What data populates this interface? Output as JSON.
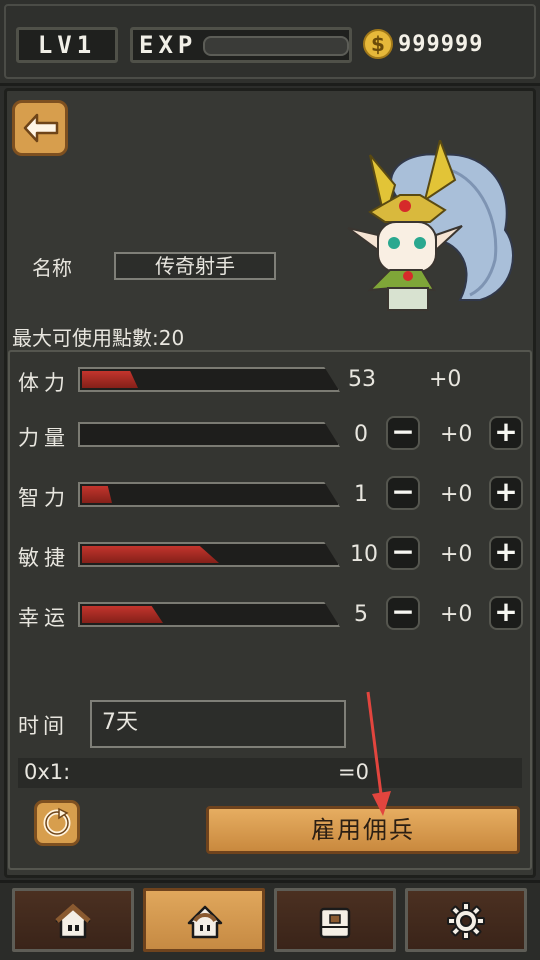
{
  "header": {
    "level": "LV1",
    "exp_label": "EXP",
    "coin_symbol": "$",
    "gold": "999999"
  },
  "panel": {
    "name_label": "名称",
    "name_value": "传奇射手",
    "max_points": "最大可使用點數:20",
    "stats": [
      {
        "label": "体力",
        "value": "53",
        "bonus": "+0",
        "fill": 0.22,
        "buttons": false
      },
      {
        "label": "力量",
        "value": "0",
        "bonus": "+0",
        "fill": 0.0,
        "buttons": true
      },
      {
        "label": "智力",
        "value": "1",
        "bonus": "+0",
        "fill": 0.12,
        "buttons": true
      },
      {
        "label": "敏捷",
        "value": "10",
        "bonus": "+0",
        "fill": 0.54,
        "buttons": true
      },
      {
        "label": "幸运",
        "value": "5",
        "bonus": "+0",
        "fill": 0.32,
        "buttons": true
      }
    ],
    "minus": "−",
    "plus": "+",
    "time_label": "时间",
    "time_value": "7天",
    "cost_left": "0x1:",
    "cost_right": "=0",
    "hire_button": "雇用佣兵"
  },
  "nav": [
    {
      "icon": "house-icon"
    },
    {
      "icon": "character-icon"
    },
    {
      "icon": "chest-icon"
    },
    {
      "icon": "gear-icon"
    }
  ],
  "colors": {
    "accent": "#d79e4d",
    "bar_fill": "#b52e27",
    "annotation_arrow": "#e2453e"
  }
}
